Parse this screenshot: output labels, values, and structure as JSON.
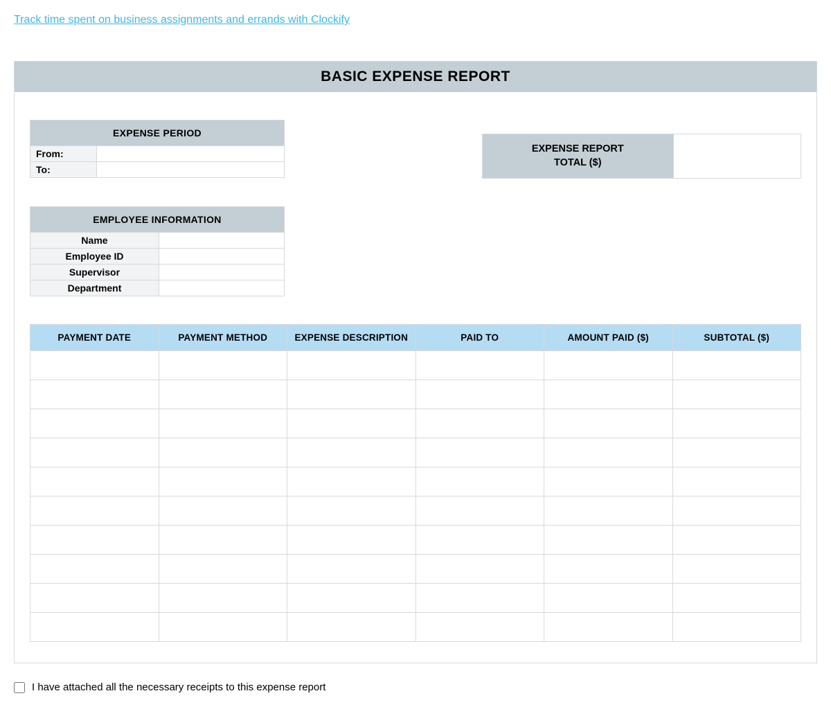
{
  "top_link": "Track time spent on business assignments and errands with Clockify",
  "title": "BASIC EXPENSE REPORT",
  "period": {
    "header": "EXPENSE PERIOD",
    "from_label": "From:",
    "to_label": "To:",
    "from_value": "",
    "to_value": ""
  },
  "total": {
    "label_line1": "EXPENSE REPORT",
    "label_line2": "TOTAL ($)",
    "value": ""
  },
  "employee": {
    "header": "EMPLOYEE INFORMATION",
    "rows": [
      {
        "label": "Name",
        "value": ""
      },
      {
        "label": "Employee ID",
        "value": ""
      },
      {
        "label": "Supervisor",
        "value": ""
      },
      {
        "label": "Department",
        "value": ""
      }
    ]
  },
  "expense_table": {
    "headers": [
      "PAYMENT DATE",
      "PAYMENT METHOD",
      "EXPENSE DESCRIPTION",
      "PAID TO",
      "AMOUNT PAID ($)",
      "SUBTOTAL ($)"
    ],
    "row_count": 10
  },
  "confirmation": {
    "label": "I have attached all the necessary receipts to this expense report",
    "checked": false
  }
}
